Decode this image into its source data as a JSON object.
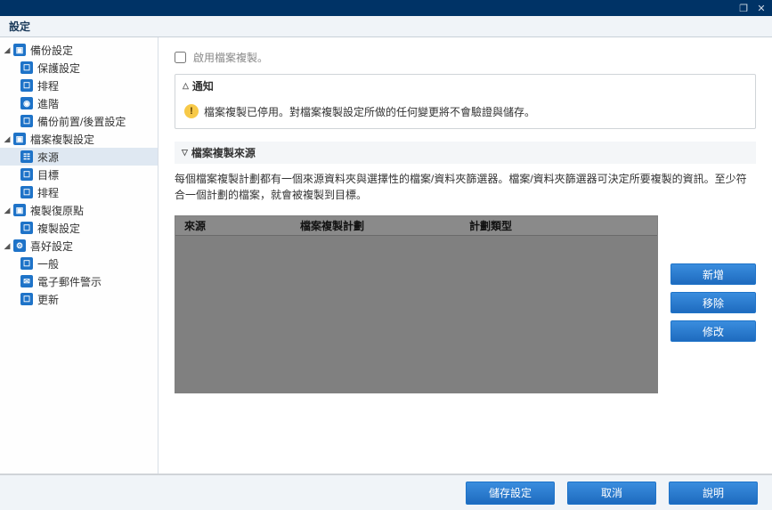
{
  "window": {
    "title": "設定"
  },
  "sidebar": {
    "items": [
      {
        "label": "備份設定",
        "children": [
          {
            "label": "保護設定"
          },
          {
            "label": "排程"
          },
          {
            "label": "進階"
          },
          {
            "label": "備份前置/後置設定"
          }
        ]
      },
      {
        "label": "檔案複製設定",
        "children": [
          {
            "label": "來源",
            "selected": true
          },
          {
            "label": "目標"
          },
          {
            "label": "排程"
          }
        ]
      },
      {
        "label": "複製復原點",
        "children": [
          {
            "label": "複製設定"
          }
        ]
      },
      {
        "label": "喜好設定",
        "children": [
          {
            "label": "一般"
          },
          {
            "label": "電子郵件警示"
          },
          {
            "label": "更新"
          }
        ]
      }
    ]
  },
  "content": {
    "enable_checkbox_label": "啟用檔案複製。",
    "notice": {
      "title": "通知",
      "message": "檔案複製已停用。對檔案複製設定所做的任何變更將不會驗證與儲存。"
    },
    "section_title": "檔案複製來源",
    "description": "每個檔案複製計劃都有一個來源資料夾與選擇性的檔案/資料夾篩選器。檔案/資料夾篩選器可決定所要複製的資訊。至少符合一個計劃的檔案，就會被複製到目標。",
    "grid": {
      "columns": [
        "來源",
        "檔案複製計劃",
        "計劃類型"
      ]
    },
    "buttons": {
      "add": "新增",
      "remove": "移除",
      "modify": "修改"
    }
  },
  "footer": {
    "save": "儲存設定",
    "cancel": "取消",
    "help": "說明"
  }
}
